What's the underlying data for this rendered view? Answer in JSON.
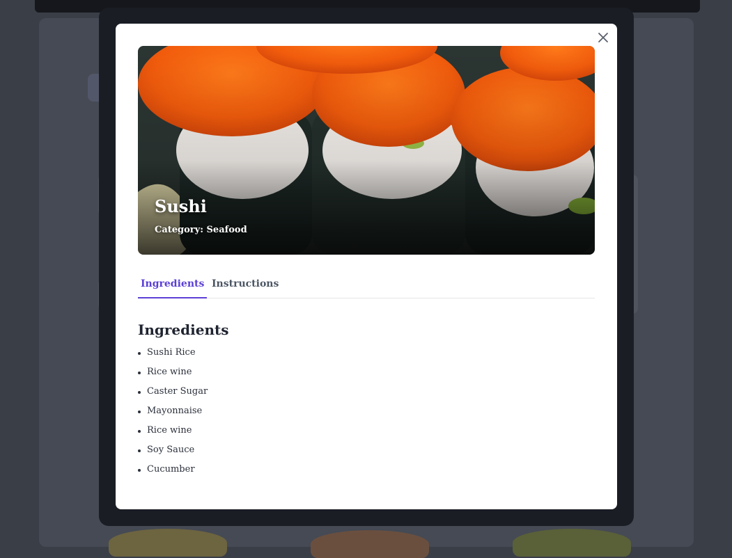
{
  "modal": {
    "close_icon": "close-icon",
    "recipe_title": "Sushi",
    "category_label": "Category:",
    "category_value": "Seafood",
    "tabs": [
      {
        "label": "Ingredients",
        "active": true
      },
      {
        "label": "Instructions",
        "active": false
      }
    ],
    "section_title": "Ingredients",
    "ingredients": [
      "Sushi Rice",
      "Rice wine",
      "Caster Sugar",
      "Mayonnaise",
      "Rice wine",
      "Soy Sauce",
      "Cucumber"
    ]
  },
  "colors": {
    "accent": "#5b3fd6",
    "overlay": "#3a3e47",
    "modal_bg": "#ffffff"
  }
}
